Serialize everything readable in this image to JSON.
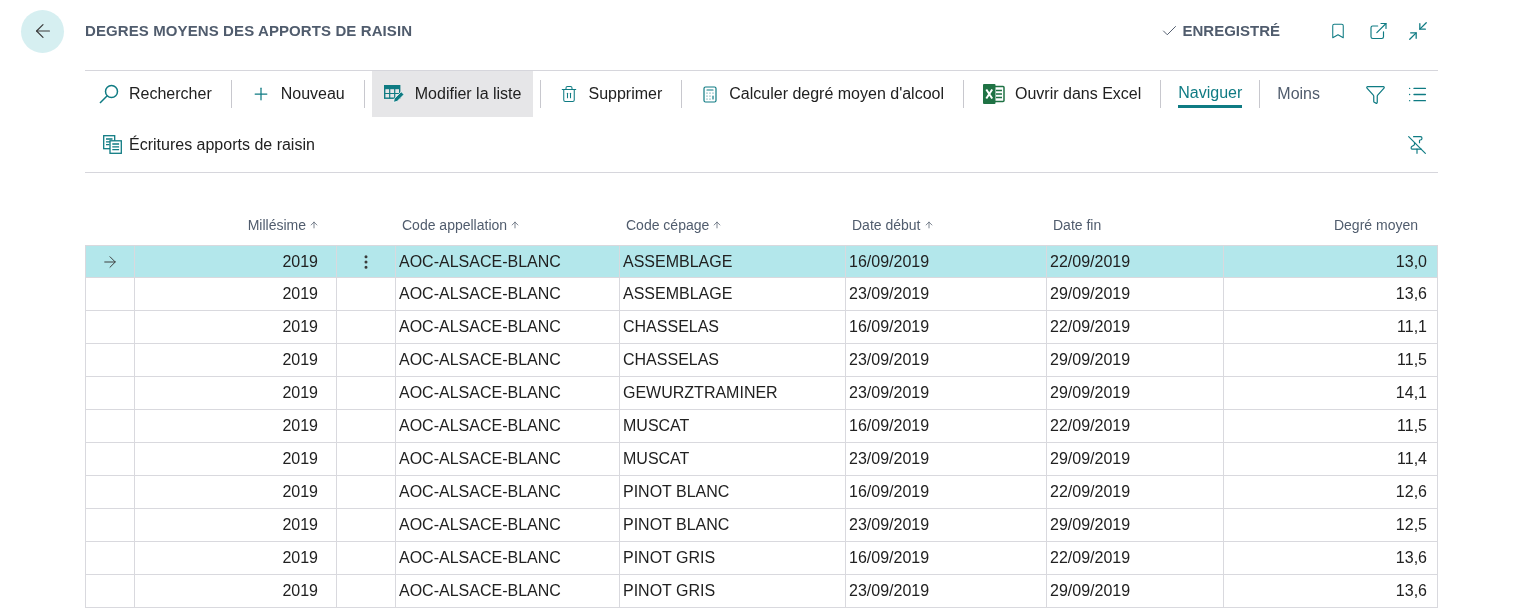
{
  "header": {
    "title": "DEGRES MOYENS DES APPORTS DE RAISIN",
    "status": "ENREGISTRÉ"
  },
  "actions": [
    {
      "label": "Rechercher",
      "highlighted": false
    },
    {
      "label": "Nouveau",
      "highlighted": false
    },
    {
      "label": "Modifier la liste",
      "highlighted": true
    },
    {
      "label": "Supprimer",
      "highlighted": false
    },
    {
      "label": "Calculer degré moyen d'alcool",
      "highlighted": false
    },
    {
      "label": "Ouvrir dans Excel",
      "highlighted": false
    }
  ],
  "menu_tabs": [
    {
      "label": "Naviguer",
      "selected": true
    }
  ],
  "less_button": {
    "label": "Moins"
  },
  "related_actions": [
    {
      "label": "Écritures apports de raisin"
    }
  ],
  "table": {
    "columns": [
      {
        "label": "Millésime",
        "sorted": true
      },
      {
        "label": "Code appellation",
        "sorted": true
      },
      {
        "label": "Code cépage",
        "sorted": true
      },
      {
        "label": "Date début",
        "sorted": true
      },
      {
        "label": "Date fin",
        "sorted": false
      },
      {
        "label": "Degré moyen",
        "sorted": false
      }
    ],
    "rows": [
      {
        "selected": true,
        "cells": [
          "2019",
          "AOC-ALSACE-BLANC",
          "ASSEMBLAGE",
          "16/09/2019",
          "22/09/2019",
          "13,0"
        ]
      },
      {
        "selected": false,
        "cells": [
          "2019",
          "AOC-ALSACE-BLANC",
          "ASSEMBLAGE",
          "23/09/2019",
          "29/09/2019",
          "13,6"
        ]
      },
      {
        "selected": false,
        "cells": [
          "2019",
          "AOC-ALSACE-BLANC",
          "CHASSELAS",
          "16/09/2019",
          "22/09/2019",
          "11,1"
        ]
      },
      {
        "selected": false,
        "cells": [
          "2019",
          "AOC-ALSACE-BLANC",
          "CHASSELAS",
          "23/09/2019",
          "29/09/2019",
          "11,5"
        ]
      },
      {
        "selected": false,
        "cells": [
          "2019",
          "AOC-ALSACE-BLANC",
          "GEWURZTRAMINER",
          "23/09/2019",
          "29/09/2019",
          "14,1"
        ]
      },
      {
        "selected": false,
        "cells": [
          "2019",
          "AOC-ALSACE-BLANC",
          "MUSCAT",
          "16/09/2019",
          "22/09/2019",
          "11,5"
        ]
      },
      {
        "selected": false,
        "cells": [
          "2019",
          "AOC-ALSACE-BLANC",
          "MUSCAT",
          "23/09/2019",
          "29/09/2019",
          "11,4"
        ]
      },
      {
        "selected": false,
        "cells": [
          "2019",
          "AOC-ALSACE-BLANC",
          "PINOT BLANC",
          "16/09/2019",
          "22/09/2019",
          "12,6"
        ]
      },
      {
        "selected": false,
        "cells": [
          "2019",
          "AOC-ALSACE-BLANC",
          "PINOT BLANC",
          "23/09/2019",
          "29/09/2019",
          "12,5"
        ]
      },
      {
        "selected": false,
        "cells": [
          "2019",
          "AOC-ALSACE-BLANC",
          "PINOT GRIS",
          "16/09/2019",
          "22/09/2019",
          "13,6"
        ]
      },
      {
        "selected": false,
        "cells": [
          "2019",
          "AOC-ALSACE-BLANC",
          "PINOT GRIS",
          "23/09/2019",
          "29/09/2019",
          "13,6"
        ]
      }
    ]
  }
}
